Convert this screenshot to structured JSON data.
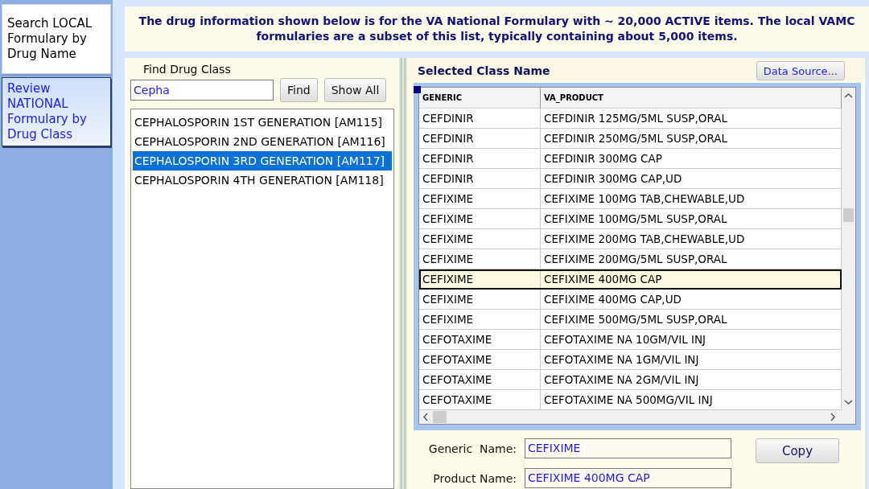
{
  "nav": {
    "items": [
      {
        "label": "Search LOCAL Formulary by Drug Name",
        "selected": false
      },
      {
        "label": "Review NATIONAL Formulary by Drug Class",
        "selected": true
      }
    ]
  },
  "banner": {
    "text": "The drug information shown below is for the VA National Formulary with ~ 20,000 ACTIVE items.  The  local VAMC formularies are a subset of this list, typically containing about 5,000 items."
  },
  "class_search": {
    "label": "Find Drug Class",
    "search": {
      "value": "Cepha"
    },
    "buttons": [
      "Find",
      "Show All"
    ],
    "classes": [
      {
        "label": "CEPHALOSPORIN 1ST GENERATION [AM115]",
        "selected": false
      },
      {
        "label": "CEPHALOSPORIN 2ND GENERATION [AM116]",
        "selected": false
      },
      {
        "label": "CEPHALOSPORIN 3RD GENERATION [AM117]",
        "selected": true
      },
      {
        "label": "CEPHALOSPORIN 4TH GENERATION [AM118]",
        "selected": false
      }
    ]
  },
  "products": {
    "title": "Selected Class Name",
    "data_source_button": "Data Source...",
    "table": {
      "columns": [
        "GENERIC",
        "VA_PRODUCT"
      ],
      "rows": [
        {
          "cells": [
            "CEFDINIR",
            "CEFDINIR 125MG/5ML SUSP,ORAL"
          ],
          "selected": false
        },
        {
          "cells": [
            "CEFDINIR",
            "CEFDINIR 250MG/5ML SUSP,ORAL"
          ],
          "selected": false
        },
        {
          "cells": [
            "CEFDINIR",
            "CEFDINIR 300MG CAP"
          ],
          "selected": false
        },
        {
          "cells": [
            "CEFDINIR",
            "CEFDINIR 300MG CAP,UD"
          ],
          "selected": false
        },
        {
          "cells": [
            "CEFIXIME",
            "CEFIXIME 100MG TAB,CHEWABLE,UD"
          ],
          "selected": false
        },
        {
          "cells": [
            "CEFIXIME",
            "CEFIXIME 100MG/5ML SUSP,ORAL"
          ],
          "selected": false
        },
        {
          "cells": [
            "CEFIXIME",
            "CEFIXIME 200MG TAB,CHEWABLE,UD"
          ],
          "selected": false
        },
        {
          "cells": [
            "CEFIXIME",
            "CEFIXIME 200MG/5ML SUSP,ORAL"
          ],
          "selected": false
        },
        {
          "cells": [
            "CEFIXIME",
            "CEFIXIME 400MG CAP"
          ],
          "selected": true
        },
        {
          "cells": [
            "CEFIXIME",
            "CEFIXIME 400MG CAP,UD"
          ],
          "selected": false
        },
        {
          "cells": [
            "CEFIXIME",
            "CEFIXIME 500MG/5ML SUSP,ORAL"
          ],
          "selected": false
        },
        {
          "cells": [
            "CEFOTAXIME",
            "CEFOTAXIME NA 10GM/VIL INJ"
          ],
          "selected": false
        },
        {
          "cells": [
            "CEFOTAXIME",
            "CEFOTAXIME NA 1GM/VIL INJ"
          ],
          "selected": false
        },
        {
          "cells": [
            "CEFOTAXIME",
            "CEFOTAXIME NA 2GM/VIL INJ"
          ],
          "selected": false
        },
        {
          "cells": [
            "CEFOTAXIME",
            "CEFOTAXIME NA 500MG/VIL INJ"
          ],
          "selected": false
        }
      ]
    },
    "details": [
      {
        "label": "Generic  Name:",
        "value": "CEFIXIME"
      },
      {
        "label": "Product Name:",
        "value": "CEFIXIME 400MG CAP"
      }
    ],
    "copy_button": "Copy"
  }
}
